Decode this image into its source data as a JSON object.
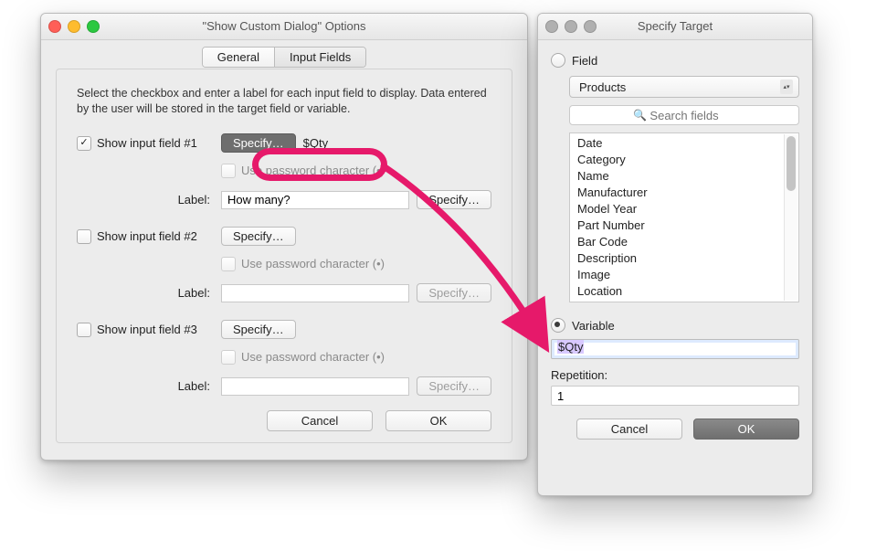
{
  "win1": {
    "title": "\"Show Custom Dialog\" Options",
    "tabs": {
      "general": "General",
      "inputFields": "Input Fields"
    },
    "instructions": "Select the checkbox and enter a label for each input field to display. Data entered by the user will be stored in the target field or variable.",
    "labels": {
      "label": "Label:"
    },
    "buttons": {
      "specify": "Specify…",
      "cancel": "Cancel",
      "ok": "OK"
    },
    "passwordText": "Use password character (•)",
    "fields": [
      {
        "checked": true,
        "name": "Show input field #1",
        "target": "$Qty",
        "label_value": "How many?"
      },
      {
        "checked": false,
        "name": "Show input field #2",
        "target": "",
        "label_value": ""
      },
      {
        "checked": false,
        "name": "Show input field #3",
        "target": "",
        "label_value": ""
      }
    ]
  },
  "win2": {
    "title": "Specify Target",
    "radio_field": "Field",
    "radio_variable": "Variable",
    "popup_value": "Products",
    "search_placeholder": "Search fields",
    "fields_list": [
      "Date",
      "Category",
      "Name",
      "Manufacturer",
      "Model Year",
      "Part Number",
      "Bar Code",
      "Description",
      "Image",
      "Location"
    ],
    "variable_value": "$Qty",
    "repetition_label": "Repetition:",
    "repetition_value": "1",
    "cancel": "Cancel",
    "ok": "OK"
  },
  "annotation": {
    "color": "#e6196a"
  }
}
